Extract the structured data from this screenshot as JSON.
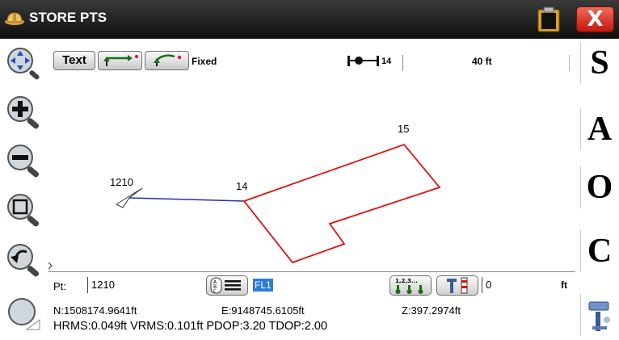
{
  "window": {
    "title": "STORE PTS",
    "logo_icon": "hardhat-logo-icon",
    "clipboard_icon": "clipboard-icon",
    "close_label": "X"
  },
  "left_toolbar": {
    "items": [
      {
        "name": "pan-tool",
        "icon": "pan-arrows-icon"
      },
      {
        "name": "zoom-in",
        "icon": "zoom-in-icon"
      },
      {
        "name": "zoom-out",
        "icon": "zoom-out-icon"
      },
      {
        "name": "zoom-window",
        "icon": "zoom-window-icon"
      },
      {
        "name": "zoom-previous",
        "icon": "zoom-previous-icon"
      },
      {
        "name": "map-options",
        "icon": "map-settings-icon"
      }
    ]
  },
  "map_toolbar": {
    "text_button": "Text",
    "mode_label": "Fixed",
    "scale_point": "14",
    "scale_distance": "40 ft"
  },
  "map": {
    "points": [
      {
        "label": "1210"
      },
      {
        "label": "14"
      },
      {
        "label": "15"
      }
    ],
    "colors": {
      "traverse": "#1f2fbf",
      "building": "#e01010"
    }
  },
  "right_toolbar": {
    "buttons": [
      "S",
      "A",
      "O",
      "C"
    ],
    "bottom_icon": "rover-icon"
  },
  "point_row": {
    "pt_label": "Pt:",
    "pt_value": "1210",
    "desc_value": "FL1",
    "rod_value": "0",
    "rod_unit": "ft"
  },
  "coordinates": {
    "n": "N:1508174.9641ft",
    "e": "E:9148745.6105ft",
    "z": "Z:397.2974ft"
  },
  "precision": "HRMS:0.049ft VRMS:0.101ft PDOP:3.20 TDOP:2.00"
}
